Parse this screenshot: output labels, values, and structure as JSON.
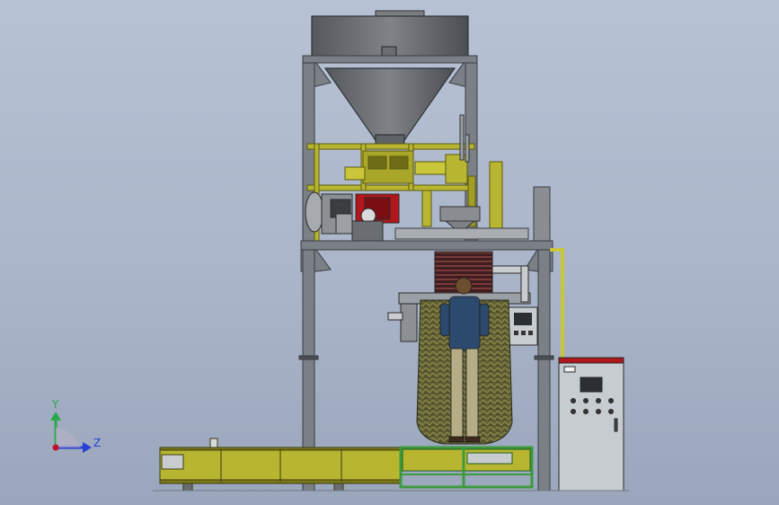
{
  "viewport": {
    "background_top": "#b7c2d4",
    "background_bottom": "#9aa6bc"
  },
  "triad": {
    "y_label": "Y",
    "z_label": "Z",
    "y_color": "#2aa84a",
    "z_color": "#2a3fd6",
    "origin_color": "#c0102a"
  },
  "colors": {
    "frame_gray": "#7b7f86",
    "frame_dark": "#44484e",
    "hopper": "#6f7378",
    "yellow_olive": "#b8b630",
    "yellow_dark": "#7d7a18",
    "green_frame": "#3c9a3c",
    "motor_red": "#b3161b",
    "cabinet": "#c7ccd1",
    "bag": "#6b6a3a"
  }
}
